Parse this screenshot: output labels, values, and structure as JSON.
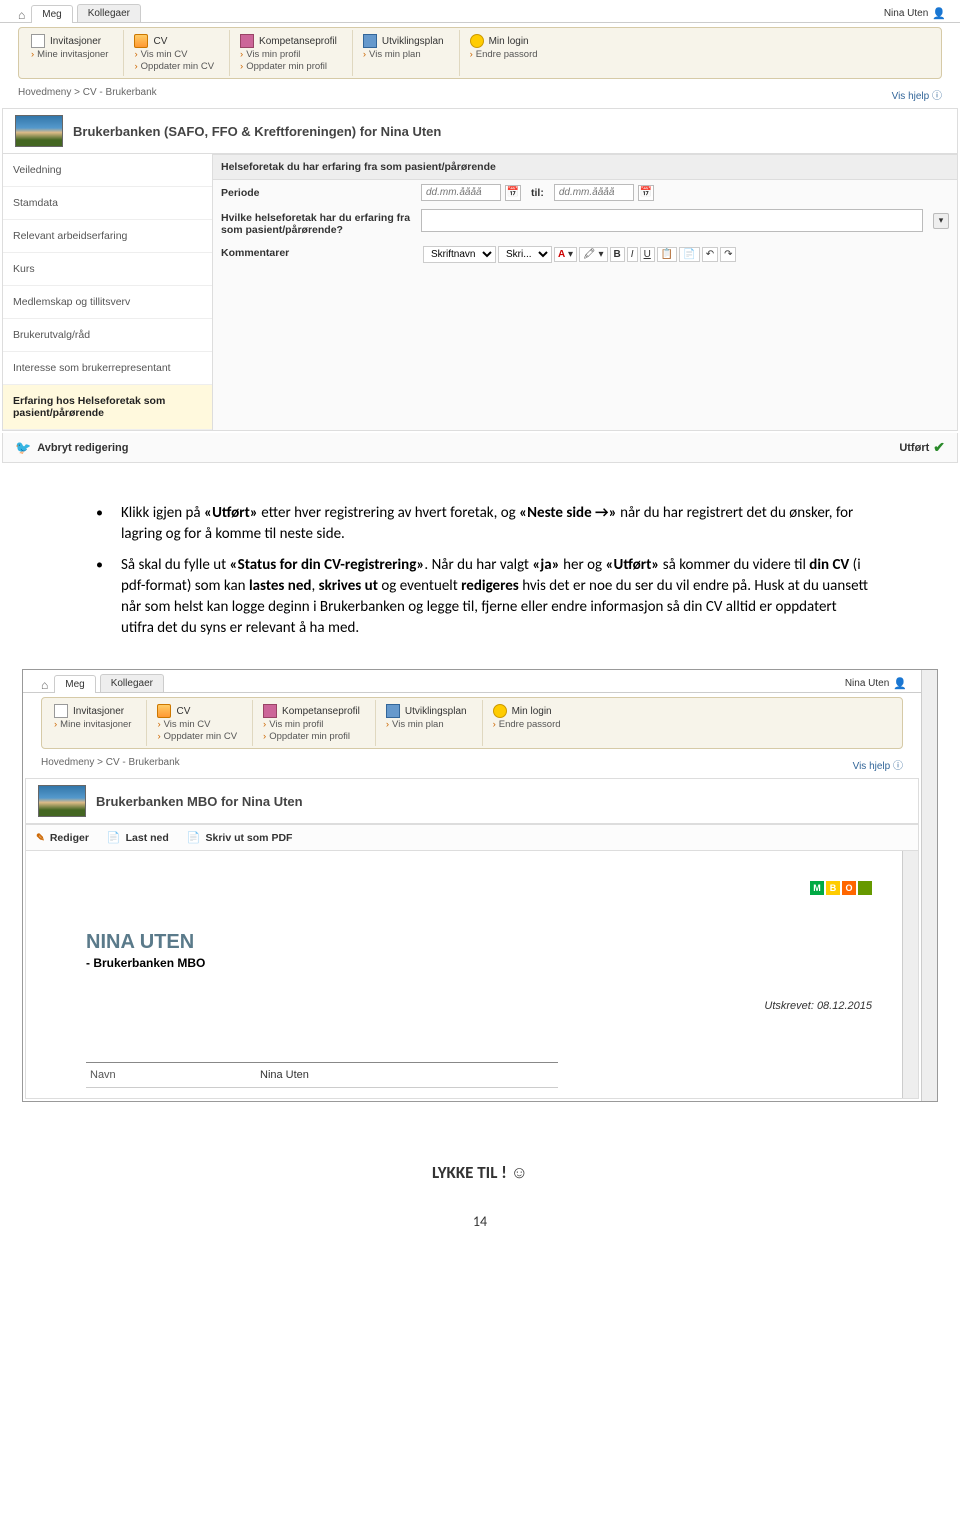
{
  "user": "Nina Uten",
  "tabs": {
    "home": "",
    "meg": "Meg",
    "kollegaer": "Kollegaer"
  },
  "toolbar": {
    "inv": {
      "title": "Invitasjoner",
      "sub1": "Mine invitasjoner"
    },
    "cv": {
      "title": "CV",
      "sub1": "Vis min CV",
      "sub2": "Oppdater min CV"
    },
    "komp": {
      "title": "Kompetanseprofil",
      "sub1": "Vis min profil",
      "sub2": "Oppdater min profil"
    },
    "plan": {
      "title": "Utviklingsplan",
      "sub1": "Vis min plan"
    },
    "login": {
      "title": "Min login",
      "sub1": "Endre passord"
    }
  },
  "breadcrumb": "Hovedmeny  >  CV - Brukerbank",
  "help": "Vis hjelp",
  "page1": {
    "title": "Brukerbanken (SAFO, FFO & Kreftforeningen) for Nina Uten",
    "sidebar": [
      "Veiledning",
      "Stamdata",
      "Relevant arbeidserfaring",
      "Kurs",
      "Medlemskap og tillitsverv",
      "Brukerutvalg/råd",
      "Interesse som brukerrepresentant",
      "Erfaring hos Helseforetak som pasient/pårørende"
    ],
    "section": "Helseforetak du har erfaring fra som pasient/pårørende",
    "fields": {
      "periode": "Periode",
      "dateplaceholder": "dd.mm.åååå",
      "til": "til:",
      "hvilke": "Hvilke helseforetak har du erfaring fra som pasient/pårørende?",
      "kommentarer": "Kommentarer"
    },
    "rte": {
      "font": "Skriftnavn",
      "size": "Skri..."
    },
    "actions": {
      "cancel": "Avbryt redigering",
      "done": "Utført"
    }
  },
  "doctext": {
    "b1_pre": "Klikk igjen på ",
    "b1_s1": "«Utført»",
    "b1_mid1": " etter hver registrering av hvert foretak, og ",
    "b1_s2": "«Neste side →»",
    "b1_mid2": " når du har registrert det du ønsker, for lagring og for å komme til neste side.",
    "b2_pre": "Så skal du fylle ut ",
    "b2_s1": "«Status for din CV-registrering»",
    "b2_mid1": ". Når du har valgt ",
    "b2_s2": "«ja»",
    "b2_mid2": " her og ",
    "b2_s3": "«Utført»",
    "b2_mid3": " så kommer du videre til ",
    "b2_s4": "din CV",
    "b2_mid4": " (i pdf-format) som kan ",
    "b2_s5": "lastes ned",
    "b2_mid5": ", ",
    "b2_s6": "skrives ut",
    "b2_mid6": " og eventuelt ",
    "b2_s7": "redigeres",
    "b2_mid7": " hvis det er noe du ser du vil endre på. Husk at du uansett når som helst kan logge deginn i Brukerbanken og legge til, fjerne eller endre informasjon så din CV alltid er oppdatert utifra det du syns er relevant å ha med."
  },
  "page2": {
    "title": "Brukerbanken MBO for Nina Uten",
    "actions": {
      "edit": "Rediger",
      "download": "Last ned",
      "print": "Skriv ut som PDF"
    },
    "cvname": "NINA UTEN",
    "cvsub": "- Brukerbanken MBO",
    "printed": "Utskrevet: 08.12.2015",
    "row1lbl": "Navn",
    "row1val": "Nina Uten",
    "mbo": {
      "m": "M",
      "b": "B",
      "o": "O"
    }
  },
  "lykke": "LYKKE TIL ! ",
  "pagenum": "14"
}
